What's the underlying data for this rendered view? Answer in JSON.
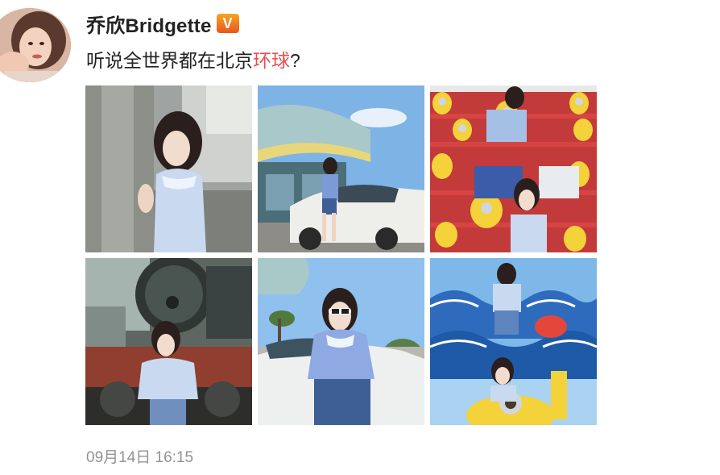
{
  "user": {
    "name": "乔欣Bridgette",
    "verified_badge": "V"
  },
  "post": {
    "text_prefix": "听说全世界都在北京",
    "topic_link": "环球",
    "text_suffix": "?",
    "timestamp": "09月14日 16:15",
    "photos": [
      {
        "icon": "photo-woman-stone-pillar"
      },
      {
        "icon": "photo-woman-white-car-blue-sky"
      },
      {
        "icon": "photo-woman-minions-shop"
      },
      {
        "icon": "photo-woman-steam-train"
      },
      {
        "icon": "photo-woman-sunglasses-white-car"
      },
      {
        "icon": "photo-woman-minions-blue-waves"
      }
    ]
  },
  "colors": {
    "username": "#222222",
    "topic_link": "#eb4d4d",
    "timestamp": "#939393",
    "verified_badge": "#f08a1f"
  }
}
